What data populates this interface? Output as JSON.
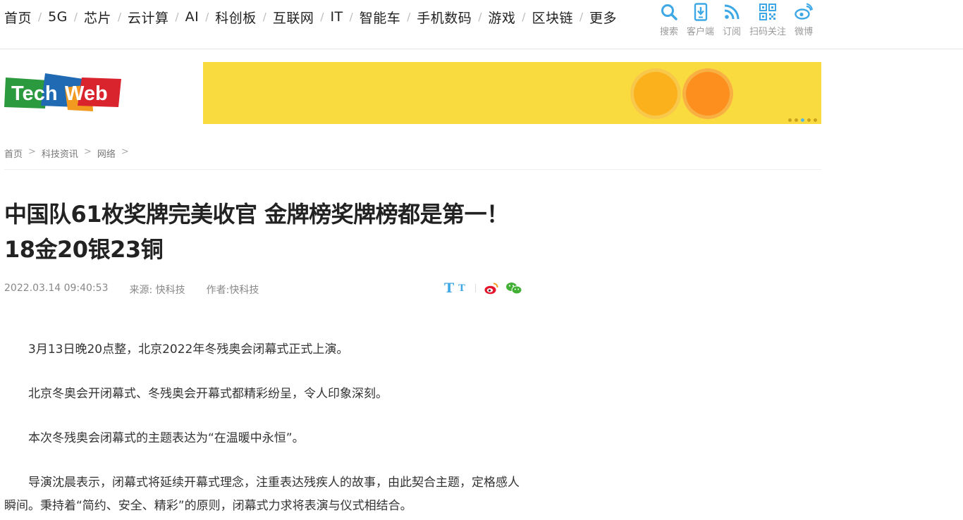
{
  "nav": {
    "items": [
      "首页",
      "5G",
      "芯片",
      "云计算",
      "AI",
      "科创板",
      "互联网",
      "IT",
      "智能车",
      "手机数码",
      "游戏",
      "区块链",
      "更多"
    ],
    "separator": "/"
  },
  "tools": [
    {
      "icon": "search-icon",
      "label": "搜索"
    },
    {
      "icon": "mobile-client-icon",
      "label": "客户端"
    },
    {
      "icon": "rss-icon",
      "label": "订阅"
    },
    {
      "icon": "qrcode-icon",
      "label": "扫码关注"
    },
    {
      "icon": "weibo-icon",
      "label": "微博"
    }
  ],
  "logo": {
    "text_left": "Tech",
    "text_right": "Web"
  },
  "breadcrumb": {
    "items": [
      "首页",
      "科技资讯",
      "网络"
    ],
    "separator": ">"
  },
  "article": {
    "title": "中国队61枚奖牌完美收官 金牌榜奖牌榜都是第一！18金20银23铜",
    "date": "2022.03.14 09:40:53",
    "source": "来源: 快科技",
    "author": "作者:快科技",
    "font_large": "T",
    "font_small": "T",
    "paragraphs": [
      "3月13日晚20点整，北京2022年冬残奥会闭幕式正式上演。",
      "北京冬奥会开闭幕式、冬残奥会开幕式都精彩纷呈，令人印象深刻。",
      "本次冬残奥会闭幕式的主题表达为“在温暖中永恒”。",
      "导演沈晨表示，闭幕式将延续开幕式理念，注重表达残疾人的故事，由此契合主题，定格感人瞬间。秉持着“简约、安全、精彩”的原则，闭幕式力求将表演与仪式相结合。"
    ]
  },
  "colors": {
    "accent_blue": "#3ea8e6",
    "banner_yellow": "#fadb3f",
    "weibo_red": "#e6162d",
    "wechat_green": "#41b035"
  }
}
